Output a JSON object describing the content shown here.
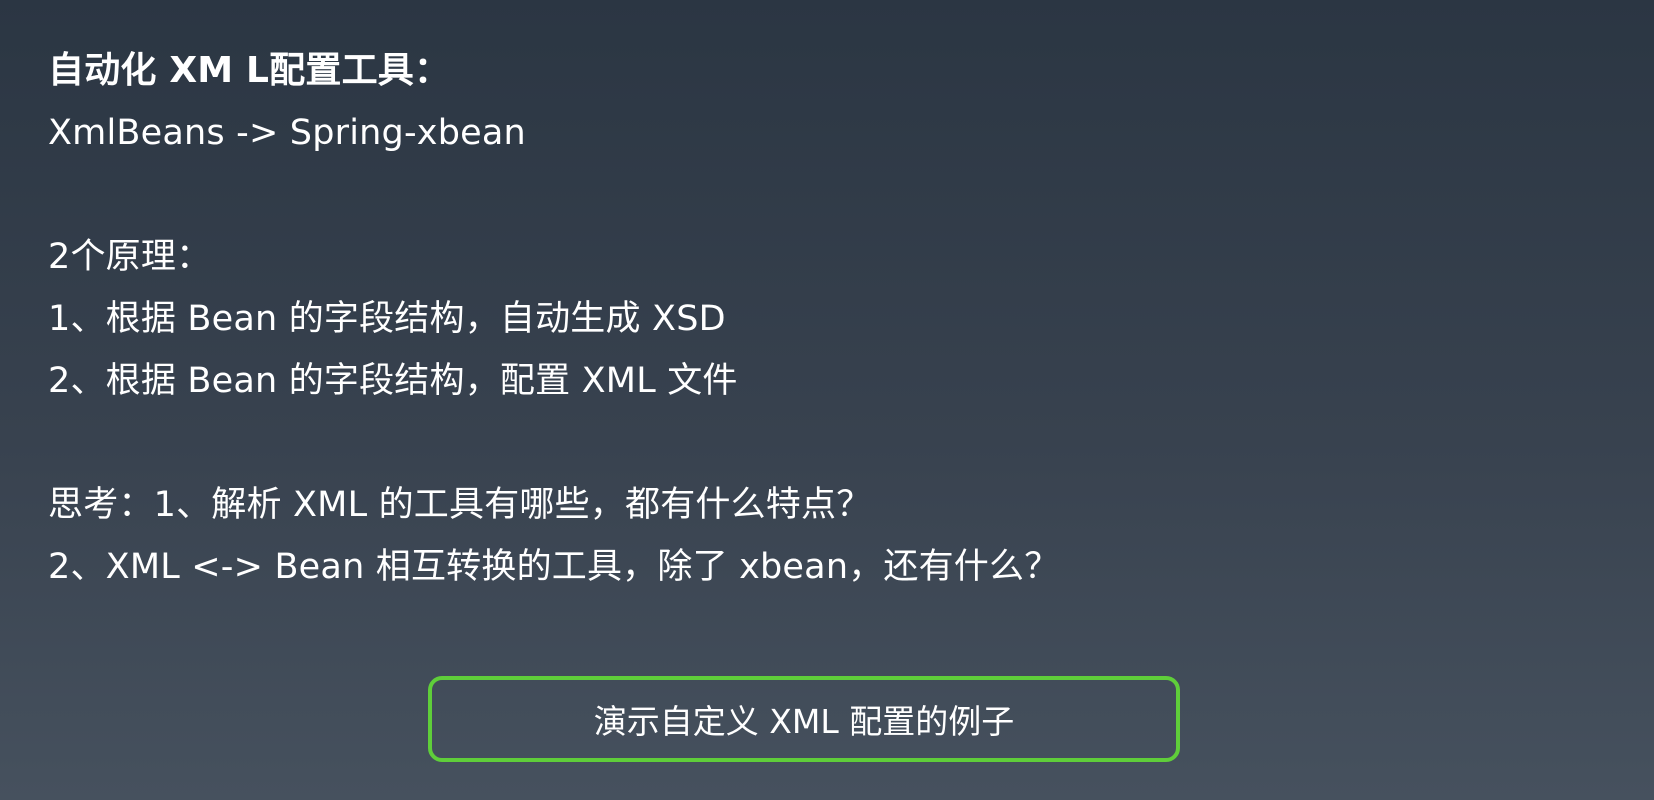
{
  "slide": {
    "title": "自动化 XM L配置工具：",
    "lines": [
      "XmlBeans -> Spring-xbean",
      "",
      "2个原理：",
      "1、根据 Bean 的字段结构，自动生成 XSD",
      "2、根据 Bean 的字段结构，配置 XML 文件",
      "",
      "思考：1、解析 XML 的工具有哪些，都有什么特点？",
      "2、XML <-> Bean 相互转换的工具，除了 xbean，还有什么？"
    ],
    "button_label": "演示自定义 XML 配置的例子"
  },
  "colors": {
    "background_top": "#2b3643",
    "background_bottom": "#46515e",
    "text": "#ffffff",
    "button_border": "#5fce3a"
  }
}
